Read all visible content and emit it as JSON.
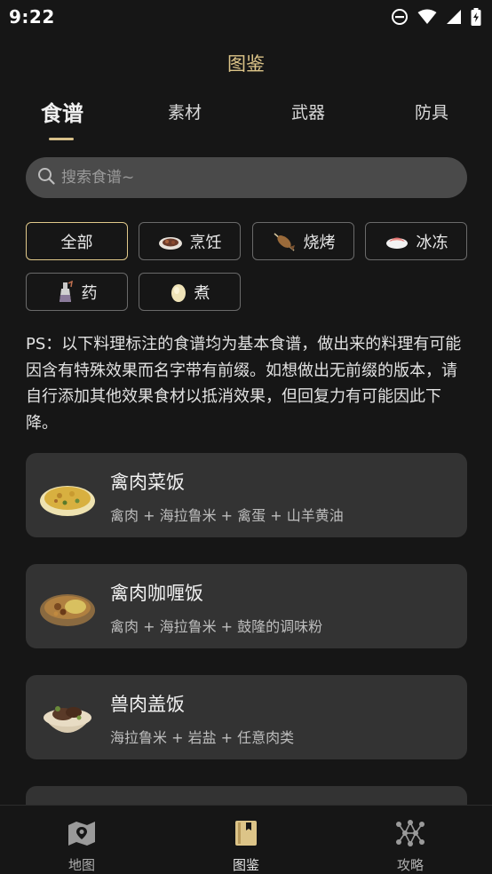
{
  "status": {
    "time": "9:22",
    "icons": [
      "do-not-disturb-icon",
      "wifi-icon",
      "signal-icon",
      "battery-charging-icon"
    ]
  },
  "header": {
    "title": "图鉴"
  },
  "tabs": [
    {
      "label": "食谱",
      "active": true
    },
    {
      "label": "素材",
      "active": false
    },
    {
      "label": "武器",
      "active": false
    },
    {
      "label": "防具",
      "active": false
    }
  ],
  "search": {
    "placeholder": "搜索食谱~",
    "value": ""
  },
  "filters": [
    {
      "label": "全部",
      "active": true,
      "icon": ""
    },
    {
      "label": "烹饪",
      "active": false,
      "icon": "cooking-plate-icon"
    },
    {
      "label": "烧烤",
      "active": false,
      "icon": "roast-fish-icon"
    },
    {
      "label": "冰冻",
      "active": false,
      "icon": "frozen-sushi-icon"
    },
    {
      "label": "药",
      "active": false,
      "icon": "elixir-bottle-icon"
    },
    {
      "label": "煮",
      "active": false,
      "icon": "boiled-egg-icon"
    }
  ],
  "note": "PS：以下料理标注的食谱均为基本食谱，做出来的料理有可能因含有特殊效果而名字带有前缀。如想做出无前缀的版本，请自行添加其他效果食材以抵消效果，但回复力有可能因此下降。",
  "recipes": [
    {
      "name": "禽肉菜饭",
      "ingredients": "禽肉 + 海拉鲁米 + 禽蛋 + 山羊黄油",
      "icon": "fried-rice-dish-icon"
    },
    {
      "name": "禽肉咖喱饭",
      "ingredients": "禽肉 + 海拉鲁米 + 鼓隆的调味粉",
      "icon": "curry-rice-dish-icon"
    },
    {
      "name": "兽肉盖饭",
      "ingredients": "海拉鲁米 + 岩盐 + 任意肉类",
      "icon": "meat-rice-bowl-icon"
    }
  ],
  "bottom_nav": [
    {
      "label": "地图",
      "active": false,
      "icon": "map-icon"
    },
    {
      "label": "图鉴",
      "active": true,
      "icon": "book-icon"
    },
    {
      "label": "攻略",
      "active": false,
      "icon": "guide-network-icon"
    }
  ],
  "colors": {
    "background": "#161616",
    "accent": "#dcc488",
    "card": "#333333",
    "search": "#4a4a4a"
  }
}
